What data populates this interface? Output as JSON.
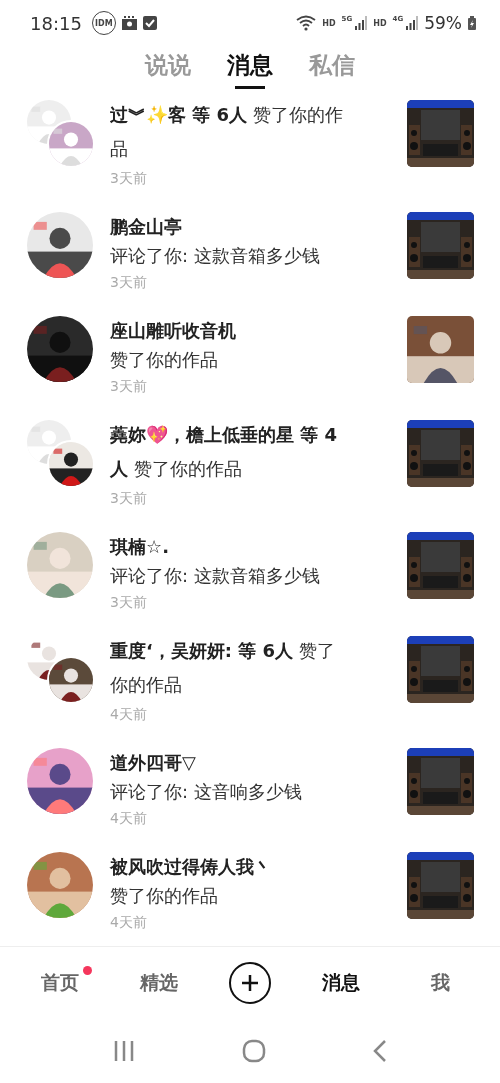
{
  "status_bar": {
    "time": "18:15",
    "notification_badge": "IDM",
    "networks": [
      {
        "hd": "HD",
        "type": "5G"
      },
      {
        "hd": "HD",
        "type": "4G"
      }
    ],
    "battery": "59%"
  },
  "tabs": [
    {
      "label": "说说",
      "selected": false
    },
    {
      "label": "消息",
      "selected": true
    },
    {
      "label": "私信",
      "selected": false
    }
  ],
  "messages": [
    {
      "kind": "group",
      "text": "**过︾✨客 等 6人** 赞了你的作品",
      "time": "3天前"
    },
    {
      "kind": "single",
      "name": "鹏金山亭",
      "action": "评论了你: 这款音箱多少钱",
      "time": "3天前"
    },
    {
      "kind": "single",
      "name": "座山雕听收音机",
      "action": "赞了你的作品",
      "time": "3天前"
    },
    {
      "kind": "group",
      "text": "**蕘妳💖，檐上低垂的星 等 4人** 赞了你的作品",
      "time": "3天前"
    },
    {
      "kind": "single",
      "name": "琪楠☆.",
      "action": "评论了你: 这款音箱多少钱",
      "time": "3天前"
    },
    {
      "kind": "group",
      "text": "**重度‘，吴妍妍: 等 6人** 赞了你的作品",
      "time": "4天前"
    },
    {
      "kind": "single",
      "name": "道外四哥▽",
      "action": "评论了你: 这音响多少钱",
      "time": "4天前"
    },
    {
      "kind": "single",
      "name": "被风吹过得俦人我丶",
      "action": "赞了你的作品",
      "time": "4天前"
    }
  ],
  "bottom_nav": [
    {
      "kind": "tab",
      "label": "首页",
      "selected": false,
      "badge": true
    },
    {
      "kind": "tab",
      "label": "精选",
      "selected": false,
      "badge": false
    },
    {
      "kind": "add"
    },
    {
      "kind": "tab",
      "label": "消息",
      "selected": true,
      "badge": false
    },
    {
      "kind": "tab",
      "label": "我",
      "selected": false,
      "badge": false
    }
  ]
}
